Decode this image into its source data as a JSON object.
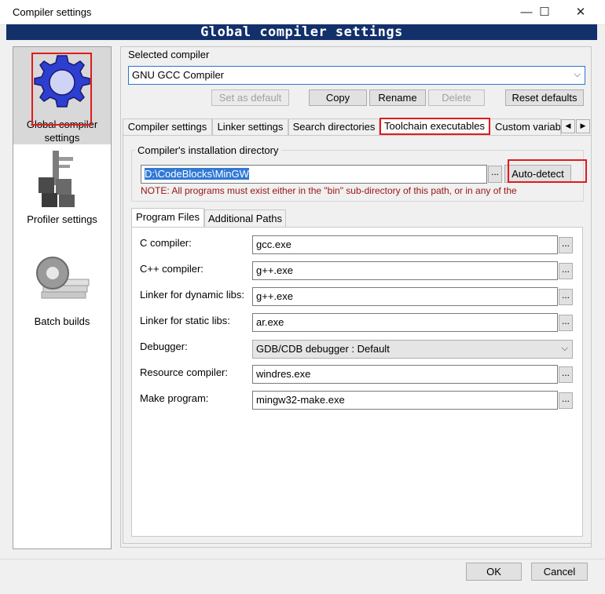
{
  "window": {
    "title": "Compiler settings",
    "minimize": "—",
    "maximize": "☐",
    "close": "✕"
  },
  "header": {
    "text": "Global compiler settings"
  },
  "sidebar": {
    "items": [
      {
        "label_line1": "Global compiler",
        "label_line2": "settings",
        "icon": "gear-icon",
        "selected": true
      },
      {
        "label_line1": "Profiler settings",
        "icon": "caliper-icon"
      },
      {
        "label_line1": "Batch builds",
        "icon": "gear-stack-icon"
      }
    ]
  },
  "selected_compiler": {
    "label": "Selected compiler",
    "value": "GNU GCC Compiler",
    "buttons": {
      "set_default": "Set as default",
      "copy": "Copy",
      "rename": "Rename",
      "delete": "Delete",
      "reset": "Reset defaults"
    }
  },
  "tabs": {
    "items": [
      "Compiler settings",
      "Linker settings",
      "Search directories",
      "Toolchain executables",
      "Custom variab"
    ],
    "active": "Toolchain executables",
    "left_arrow": "◀",
    "right_arrow": "▶"
  },
  "install_dir": {
    "group_label": "Compiler's installation directory",
    "value": "D:\\CodeBlocks\\MinGW",
    "browse": "...",
    "auto_detect": "Auto-detect",
    "note": "NOTE: All programs must exist either in the \"bin\" sub-directory of this path, or in any of the"
  },
  "subtabs": {
    "program_files": "Program Files",
    "additional_paths": "Additional Paths"
  },
  "programs": [
    {
      "label": "C compiler:",
      "value": "gcc.exe",
      "browse": "..."
    },
    {
      "label": "C++ compiler:",
      "value": "g++.exe",
      "browse": "..."
    },
    {
      "label": "Linker for dynamic libs:",
      "value": "g++.exe",
      "browse": "..."
    },
    {
      "label": "Linker for static libs:",
      "value": "ar.exe",
      "browse": "..."
    },
    {
      "label": "Debugger:",
      "value": "GDB/CDB debugger : Default"
    },
    {
      "label": "Resource compiler:",
      "value": "windres.exe",
      "browse": "..."
    },
    {
      "label": "Make program:",
      "value": "mingw32-make.exe",
      "browse": "..."
    }
  ],
  "footer": {
    "ok": "OK",
    "cancel": "Cancel"
  },
  "colors": {
    "header_band": "#12306a",
    "highlight_box": "#e01b1b",
    "note_text": "#9b1313",
    "selection": "#3179d4"
  }
}
